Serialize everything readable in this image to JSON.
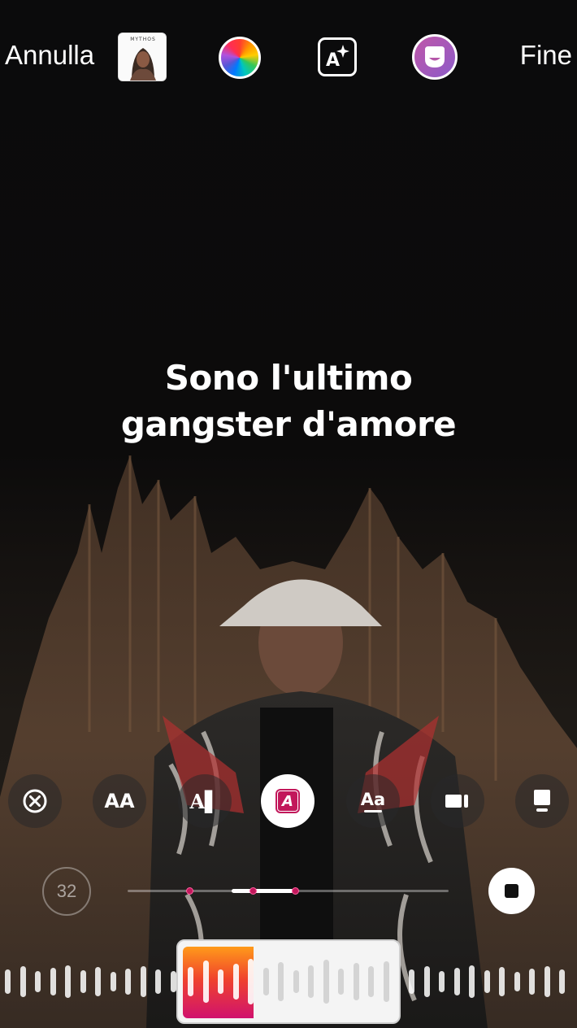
{
  "topbar": {
    "cancel_label": "Annulla",
    "done_label": "Fine",
    "album_art_text": "MYTHOS"
  },
  "lyrics": {
    "line1": "Sono l'ultimo",
    "line2": "gangster d'amore"
  },
  "style_options": [
    {
      "name": "font-style-classic",
      "glyph": "AA"
    },
    {
      "name": "font-style-typewriter",
      "glyph": "A▌"
    },
    {
      "name": "font-style-highlight",
      "glyph": "A",
      "selected": true
    },
    {
      "name": "font-style-subtitle",
      "glyph": "Aa"
    },
    {
      "name": "layout-card",
      "glyph": ""
    },
    {
      "name": "layout-poster",
      "glyph": ""
    }
  ],
  "player": {
    "clip_duration": "32",
    "progress_fraction": 0.33
  },
  "colors": {
    "accent_red": "#e5322d",
    "highlight_magenta": "#c2185b",
    "gradient_orange": "#ff9a1a"
  }
}
